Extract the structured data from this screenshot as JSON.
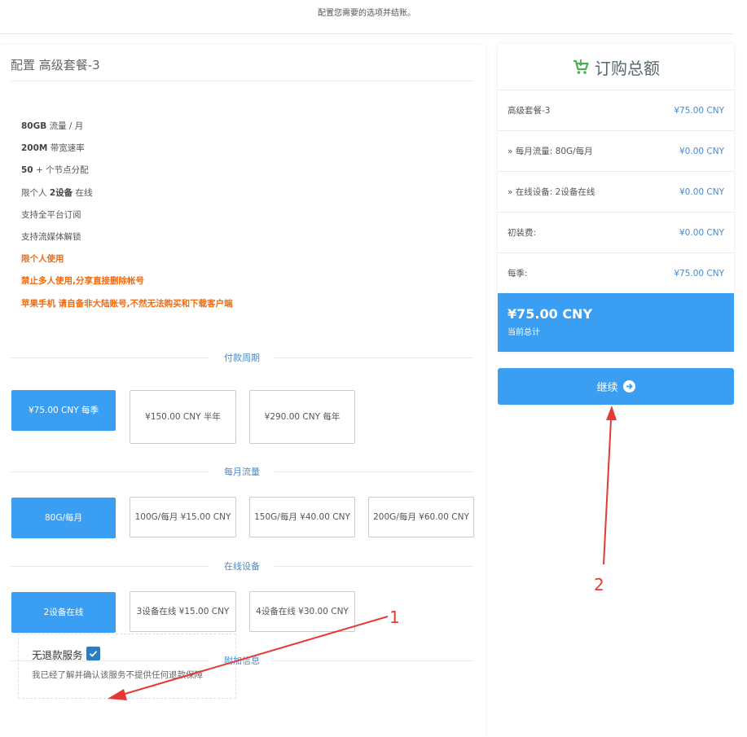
{
  "top_note": "配置您需要的选项并结账。",
  "config": {
    "title": "配置 高级套餐-3",
    "features": [
      {
        "bold": "80GB",
        "text": " 流量 / 月"
      },
      {
        "bold": "200M",
        "text": " 带宽速率"
      },
      {
        "bold": "50",
        "text": " + 个节点分配"
      },
      {
        "pre": "限个人 ",
        "bold": "2设备",
        "text": " 在线"
      },
      {
        "text": "支持全平台订阅"
      },
      {
        "text": "支持流媒体解锁"
      },
      {
        "warn": "限个人使用"
      },
      {
        "warn": "禁止多人使用,分享直接删除帐号"
      },
      {
        "warn": "苹果手机 请自备非大陆账号,不然无法购买和下载客户端"
      }
    ]
  },
  "billing": {
    "label": "付款周期",
    "options": [
      {
        "label": "¥75.00 CNY 每季",
        "selected": true
      },
      {
        "label": "¥150.00 CNY 半年",
        "selected": false
      },
      {
        "label": "¥290.00 CNY 每年",
        "selected": false
      }
    ]
  },
  "traffic": {
    "label": "每月流量",
    "options": [
      {
        "label": "80G/每月",
        "selected": true
      },
      {
        "label": "100G/每月 ¥15.00 CNY",
        "selected": false
      },
      {
        "label": "150G/每月 ¥40.00 CNY",
        "selected": false
      },
      {
        "label": "200G/每月 ¥60.00 CNY",
        "selected": false
      }
    ]
  },
  "devices": {
    "label": "在线设备",
    "options": [
      {
        "label": "2设备在线",
        "selected": true
      },
      {
        "label": "3设备在线 ¥15.00 CNY",
        "selected": false
      },
      {
        "label": "4设备在线 ¥30.00 CNY",
        "selected": false
      }
    ]
  },
  "addons": {
    "label": "附加信息",
    "name": "无退款服务",
    "checked": true,
    "description": "我已经了解并确认该服务不提供任何退款保障"
  },
  "summary": {
    "title": "订购总额",
    "rows": [
      {
        "label": "高级套餐-3",
        "price": "¥75.00 CNY"
      },
      {
        "label": "» 每月流量: 80G/每月",
        "price": "¥0.00 CNY"
      },
      {
        "label": "» 在线设备: 2设备在线",
        "price": "¥0.00 CNY"
      },
      {
        "label": "初装费:",
        "price": "¥0.00 CNY"
      },
      {
        "label": "每季:",
        "price": "¥75.00 CNY"
      }
    ],
    "total_amount": "¥75.00 CNY",
    "total_label": "当前总计"
  },
  "continue_label": "继续",
  "annotations": {
    "marker_1": "1",
    "marker_2": "2"
  },
  "colors": {
    "primary": "#3a9ff2",
    "warning": "#ee6b12",
    "annotation": "#e53935",
    "cart": "#4caf50"
  }
}
